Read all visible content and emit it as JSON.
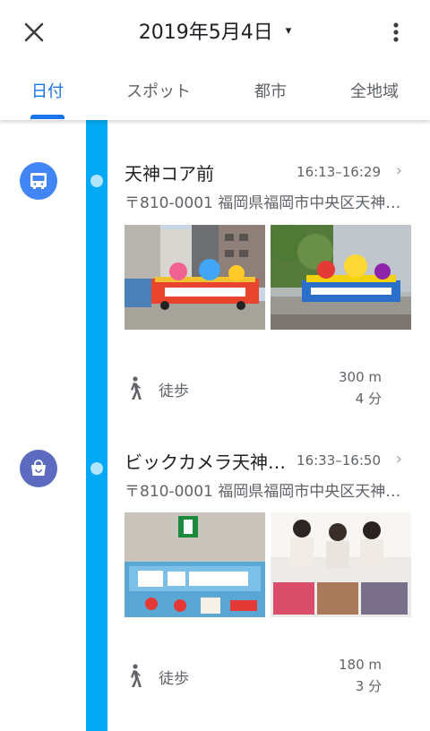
{
  "header": {
    "date": "2019年5月4日",
    "dropdown_glyph": "▾",
    "close_icon": "close-icon",
    "more_icon": "more-vert-icon"
  },
  "tabs": [
    {
      "label": "日付",
      "active": true
    },
    {
      "label": "スポット",
      "active": false
    },
    {
      "label": "都市",
      "active": false
    },
    {
      "label": "全地域",
      "active": false
    }
  ],
  "colors": {
    "accent": "#1a73e8",
    "timeline": "#03a9f4",
    "timeline_dot": "#b3e5fc",
    "transit_icon_bg": "#4285f4",
    "shopping_icon_bg": "#5c6bc0"
  },
  "places": [
    {
      "name": "天神コア前",
      "time": "16:13–16:29",
      "address": "〒810-0001 福岡県福岡市中央区天神…",
      "icon": "bus-icon",
      "photos": [
        "parade-float-photo",
        "parade-float-photo"
      ]
    },
    {
      "name": "ビックカメラ天神…",
      "time": "16:33–16:50",
      "address": "〒810-0001 福岡県福岡市中央区天神…",
      "icon": "shopping-bag-icon",
      "photos": [
        "poster-photo",
        "people-photo"
      ]
    }
  ],
  "walks": [
    {
      "label": "徒歩",
      "distance": "300 m",
      "duration": "4 分"
    },
    {
      "label": "徒歩",
      "distance": "180 m",
      "duration": "3 分"
    }
  ]
}
